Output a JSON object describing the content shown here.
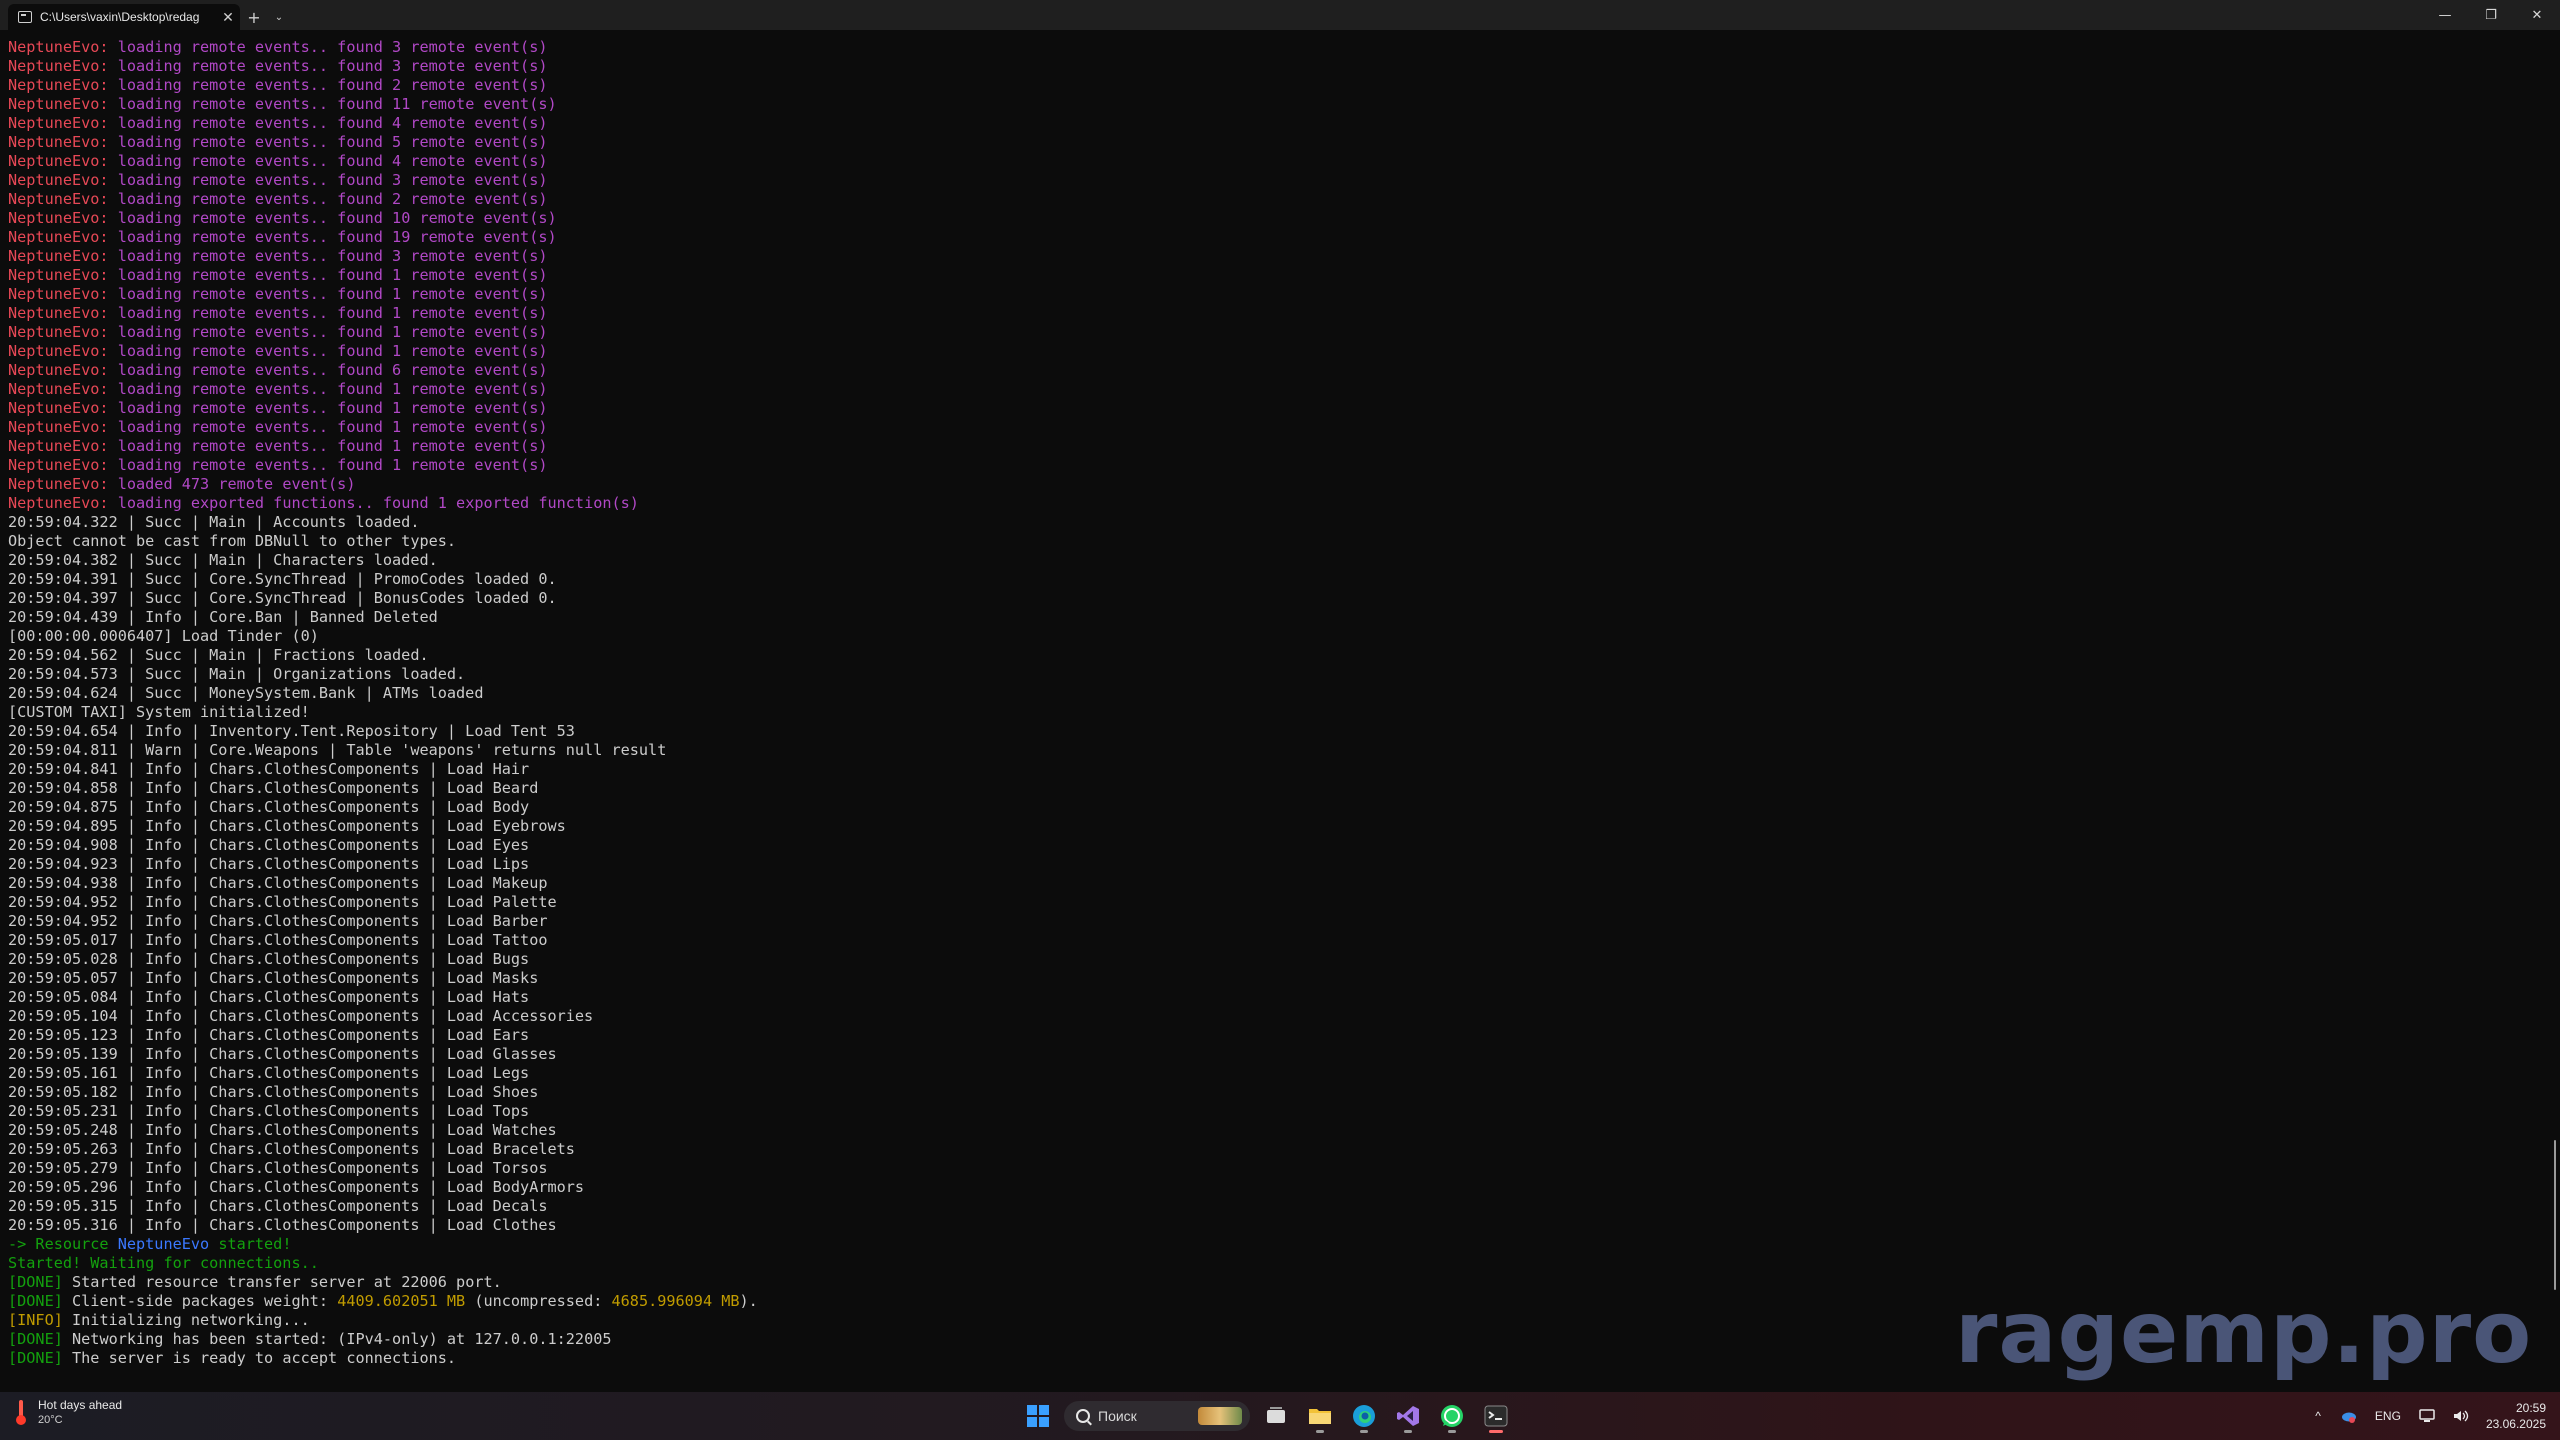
{
  "window": {
    "tab_title": "C:\\Users\\vaxin\\Desktop\\redag",
    "tab_close": "✕",
    "new_tab": "+",
    "tab_dropdown": "⌄",
    "minimize": "—",
    "maximize": "❐",
    "close": "✕"
  },
  "console": {
    "lines": [
      [
        {
          "t": "NeptuneEvo:",
          "c": "r"
        },
        {
          "t": " loading remote events.. found 3 remote event(s)",
          "c": "m"
        }
      ],
      [
        {
          "t": "NeptuneEvo:",
          "c": "r"
        },
        {
          "t": " loading remote events.. found 3 remote event(s)",
          "c": "m"
        }
      ],
      [
        {
          "t": "NeptuneEvo:",
          "c": "r"
        },
        {
          "t": " loading remote events.. found 2 remote event(s)",
          "c": "m"
        }
      ],
      [
        {
          "t": "NeptuneEvo:",
          "c": "r"
        },
        {
          "t": " loading remote events.. found 11 remote event(s)",
          "c": "m"
        }
      ],
      [
        {
          "t": "NeptuneEvo:",
          "c": "r"
        },
        {
          "t": " loading remote events.. found 4 remote event(s)",
          "c": "m"
        }
      ],
      [
        {
          "t": "NeptuneEvo:",
          "c": "r"
        },
        {
          "t": " loading remote events.. found 5 remote event(s)",
          "c": "m"
        }
      ],
      [
        {
          "t": "NeptuneEvo:",
          "c": "r"
        },
        {
          "t": " loading remote events.. found 4 remote event(s)",
          "c": "m"
        }
      ],
      [
        {
          "t": "NeptuneEvo:",
          "c": "r"
        },
        {
          "t": " loading remote events.. found 3 remote event(s)",
          "c": "m"
        }
      ],
      [
        {
          "t": "NeptuneEvo:",
          "c": "r"
        },
        {
          "t": " loading remote events.. found 2 remote event(s)",
          "c": "m"
        }
      ],
      [
        {
          "t": "NeptuneEvo:",
          "c": "r"
        },
        {
          "t": " loading remote events.. found 10 remote event(s)",
          "c": "m"
        }
      ],
      [
        {
          "t": "NeptuneEvo:",
          "c": "r"
        },
        {
          "t": " loading remote events.. found 19 remote event(s)",
          "c": "m"
        }
      ],
      [
        {
          "t": "NeptuneEvo:",
          "c": "r"
        },
        {
          "t": " loading remote events.. found 3 remote event(s)",
          "c": "m"
        }
      ],
      [
        {
          "t": "NeptuneEvo:",
          "c": "r"
        },
        {
          "t": " loading remote events.. found 1 remote event(s)",
          "c": "m"
        }
      ],
      [
        {
          "t": "NeptuneEvo:",
          "c": "r"
        },
        {
          "t": " loading remote events.. found 1 remote event(s)",
          "c": "m"
        }
      ],
      [
        {
          "t": "NeptuneEvo:",
          "c": "r"
        },
        {
          "t": " loading remote events.. found 1 remote event(s)",
          "c": "m"
        }
      ],
      [
        {
          "t": "NeptuneEvo:",
          "c": "r"
        },
        {
          "t": " loading remote events.. found 1 remote event(s)",
          "c": "m"
        }
      ],
      [
        {
          "t": "NeptuneEvo:",
          "c": "r"
        },
        {
          "t": " loading remote events.. found 1 remote event(s)",
          "c": "m"
        }
      ],
      [
        {
          "t": "NeptuneEvo:",
          "c": "r"
        },
        {
          "t": " loading remote events.. found 6 remote event(s)",
          "c": "m"
        }
      ],
      [
        {
          "t": "NeptuneEvo:",
          "c": "r"
        },
        {
          "t": " loading remote events.. found 1 remote event(s)",
          "c": "m"
        }
      ],
      [
        {
          "t": "NeptuneEvo:",
          "c": "r"
        },
        {
          "t": " loading remote events.. found 1 remote event(s)",
          "c": "m"
        }
      ],
      [
        {
          "t": "NeptuneEvo:",
          "c": "r"
        },
        {
          "t": " loading remote events.. found 1 remote event(s)",
          "c": "m"
        }
      ],
      [
        {
          "t": "NeptuneEvo:",
          "c": "r"
        },
        {
          "t": " loading remote events.. found 1 remote event(s)",
          "c": "m"
        }
      ],
      [
        {
          "t": "NeptuneEvo:",
          "c": "r"
        },
        {
          "t": " loading remote events.. found 1 remote event(s)",
          "c": "m"
        }
      ],
      [
        {
          "t": "NeptuneEvo:",
          "c": "r"
        },
        {
          "t": " loaded 473 remote event(s)",
          "c": "m"
        }
      ],
      [
        {
          "t": "NeptuneEvo:",
          "c": "r"
        },
        {
          "t": " loading exported functions.. found 1 exported function(s)",
          "c": "m"
        }
      ],
      [
        {
          "t": "20:59:04.322 | Succ | Main | Accounts loaded.",
          "c": "w"
        }
      ],
      [
        {
          "t": "Object cannot be cast from DBNull to other types.",
          "c": "w"
        }
      ],
      [
        {
          "t": "20:59:04.382 | Succ | Main | Characters loaded.",
          "c": "w"
        }
      ],
      [
        {
          "t": "20:59:04.391 | Succ | Core.SyncThread | PromoCodes loaded 0.",
          "c": "w"
        }
      ],
      [
        {
          "t": "20:59:04.397 | Succ | Core.SyncThread | BonusCodes loaded 0.",
          "c": "w"
        }
      ],
      [
        {
          "t": "20:59:04.439 | Info | Core.Ban | Banned Deleted",
          "c": "w"
        }
      ],
      [
        {
          "t": "[00:00:00.0006407] Load Tinder (0)",
          "c": "w"
        }
      ],
      [
        {
          "t": "20:59:04.562 | Succ | Main | Fractions loaded.",
          "c": "w"
        }
      ],
      [
        {
          "t": "20:59:04.573 | Succ | Main | Organizations loaded.",
          "c": "w"
        }
      ],
      [
        {
          "t": "20:59:04.624 | Succ | MoneySystem.Bank | ATMs loaded",
          "c": "w"
        }
      ],
      [
        {
          "t": "[CUSTOM TAXI] System initialized!",
          "c": "w"
        }
      ],
      [
        {
          "t": "20:59:04.654 | Info | Inventory.Tent.Repository | Load Tent 53",
          "c": "w"
        }
      ],
      [
        {
          "t": "20:59:04.811 | Warn | Core.Weapons | Table 'weapons' returns null result",
          "c": "w"
        }
      ],
      [
        {
          "t": "20:59:04.841 | Info | Chars.ClothesComponents | Load Hair",
          "c": "w"
        }
      ],
      [
        {
          "t": "20:59:04.858 | Info | Chars.ClothesComponents | Load Beard",
          "c": "w"
        }
      ],
      [
        {
          "t": "20:59:04.875 | Info | Chars.ClothesComponents | Load Body",
          "c": "w"
        }
      ],
      [
        {
          "t": "20:59:04.895 | Info | Chars.ClothesComponents | Load Eyebrows",
          "c": "w"
        }
      ],
      [
        {
          "t": "20:59:04.908 | Info | Chars.ClothesComponents | Load Eyes",
          "c": "w"
        }
      ],
      [
        {
          "t": "20:59:04.923 | Info | Chars.ClothesComponents | Load Lips",
          "c": "w"
        }
      ],
      [
        {
          "t": "20:59:04.938 | Info | Chars.ClothesComponents | Load Makeup",
          "c": "w"
        }
      ],
      [
        {
          "t": "20:59:04.952 | Info | Chars.ClothesComponents | Load Palette",
          "c": "w"
        }
      ],
      [
        {
          "t": "20:59:04.952 | Info | Chars.ClothesComponents | Load Barber",
          "c": "w"
        }
      ],
      [
        {
          "t": "20:59:05.017 | Info | Chars.ClothesComponents | Load Tattoo",
          "c": "w"
        }
      ],
      [
        {
          "t": "20:59:05.028 | Info | Chars.ClothesComponents | Load Bugs",
          "c": "w"
        }
      ],
      [
        {
          "t": "20:59:05.057 | Info | Chars.ClothesComponents | Load Masks",
          "c": "w"
        }
      ],
      [
        {
          "t": "20:59:05.084 | Info | Chars.ClothesComponents | Load Hats",
          "c": "w"
        }
      ],
      [
        {
          "t": "20:59:05.104 | Info | Chars.ClothesComponents | Load Accessories",
          "c": "w"
        }
      ],
      [
        {
          "t": "20:59:05.123 | Info | Chars.ClothesComponents | Load Ears",
          "c": "w"
        }
      ],
      [
        {
          "t": "20:59:05.139 | Info | Chars.ClothesComponents | Load Glasses",
          "c": "w"
        }
      ],
      [
        {
          "t": "20:59:05.161 | Info | Chars.ClothesComponents | Load Legs",
          "c": "w"
        }
      ],
      [
        {
          "t": "20:59:05.182 | Info | Chars.ClothesComponents | Load Shoes",
          "c": "w"
        }
      ],
      [
        {
          "t": "20:59:05.231 | Info | Chars.ClothesComponents | Load Tops",
          "c": "w"
        }
      ],
      [
        {
          "t": "20:59:05.248 | Info | Chars.ClothesComponents | Load Watches",
          "c": "w"
        }
      ],
      [
        {
          "t": "20:59:05.263 | Info | Chars.ClothesComponents | Load Bracelets",
          "c": "w"
        }
      ],
      [
        {
          "t": "20:59:05.279 | Info | Chars.ClothesComponents | Load Torsos",
          "c": "w"
        }
      ],
      [
        {
          "t": "20:59:05.296 | Info | Chars.ClothesComponents | Load BodyArmors",
          "c": "w"
        }
      ],
      [
        {
          "t": "20:59:05.315 | Info | Chars.ClothesComponents | Load Decals",
          "c": "w"
        }
      ],
      [
        {
          "t": "20:59:05.316 | Info | Chars.ClothesComponents | Load Clothes",
          "c": "w"
        }
      ],
      [
        {
          "t": "-> Resource ",
          "c": "g"
        },
        {
          "t": "NeptuneEvo",
          "c": "b"
        },
        {
          "t": " started!",
          "c": "g"
        }
      ],
      [
        {
          "t": "Started! Waiting for connections..",
          "c": "g"
        }
      ],
      [
        {
          "t": "[DONE]",
          "c": "g"
        },
        {
          "t": " Started resource transfer server at 22006 port.",
          "c": "w"
        }
      ],
      [
        {
          "t": "[DONE]",
          "c": "g"
        },
        {
          "t": " Client-side packages weight: ",
          "c": "w"
        },
        {
          "t": "4409.602051 MB",
          "c": "y"
        },
        {
          "t": " (uncompressed: ",
          "c": "w"
        },
        {
          "t": "4685.996094 MB",
          "c": "y"
        },
        {
          "t": ").",
          "c": "w"
        }
      ],
      [
        {
          "t": "[INFO]",
          "c": "y"
        },
        {
          "t": " Initializing networking...",
          "c": "w"
        }
      ],
      [
        {
          "t": "[DONE]",
          "c": "g"
        },
        {
          "t": " Networking has been started: (IPv4-only) at 127.0.0.1:22005",
          "c": "w"
        }
      ],
      [
        {
          "t": "[DONE]",
          "c": "g"
        },
        {
          "t": " The server is ready to accept connections.",
          "c": "w"
        }
      ]
    ]
  },
  "watermark": "ragemp.pro",
  "taskbar": {
    "weather_title": "Hot days ahead",
    "weather_temp": "20°C",
    "search_placeholder": "Поиск",
    "lang": "ENG",
    "time": "20:59",
    "date": "23.06.2025",
    "tray_chevron": "^"
  },
  "colors": {
    "r": "#e74856",
    "m": "#b148c6",
    "g": "#13a10e",
    "b": "#3b78ff",
    "y": "#c19c00",
    "w": "#cccccc"
  },
  "icons": [
    "console-icon",
    "windows-start-icon",
    "search-icon",
    "task-view-icon",
    "file-explorer-icon",
    "edge-icon",
    "visual-studio-icon",
    "whatsapp-icon",
    "terminal-icon",
    "network-icon",
    "volume-icon",
    "onedrive-icon",
    "thermometer-icon"
  ]
}
